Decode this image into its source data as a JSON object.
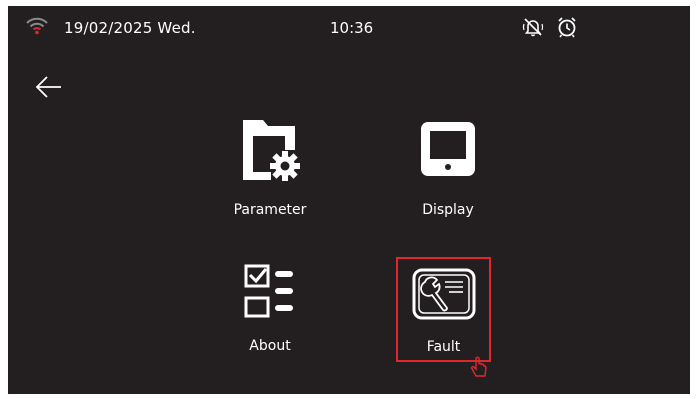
{
  "status_bar": {
    "date": "19/02/2025 Wed.",
    "time": "10:36",
    "icons": [
      "wifi-icon",
      "mute-bell-icon",
      "alarm-clock-icon"
    ]
  },
  "nav": {
    "back_icon": "arrow-left-icon"
  },
  "menu": {
    "items": [
      {
        "label": "Parameter",
        "icon": "folder-gear-icon"
      },
      {
        "label": "Display",
        "icon": "monitor-icon"
      },
      {
        "label": "About",
        "icon": "checklist-icon"
      },
      {
        "label": "Fault",
        "icon": "wrench-screen-icon",
        "highlighted": true
      }
    ]
  },
  "colors": {
    "background": "#231f20",
    "text": "#ffffff",
    "highlight": "#e0282c",
    "wifi_accent": "#e0282c"
  }
}
